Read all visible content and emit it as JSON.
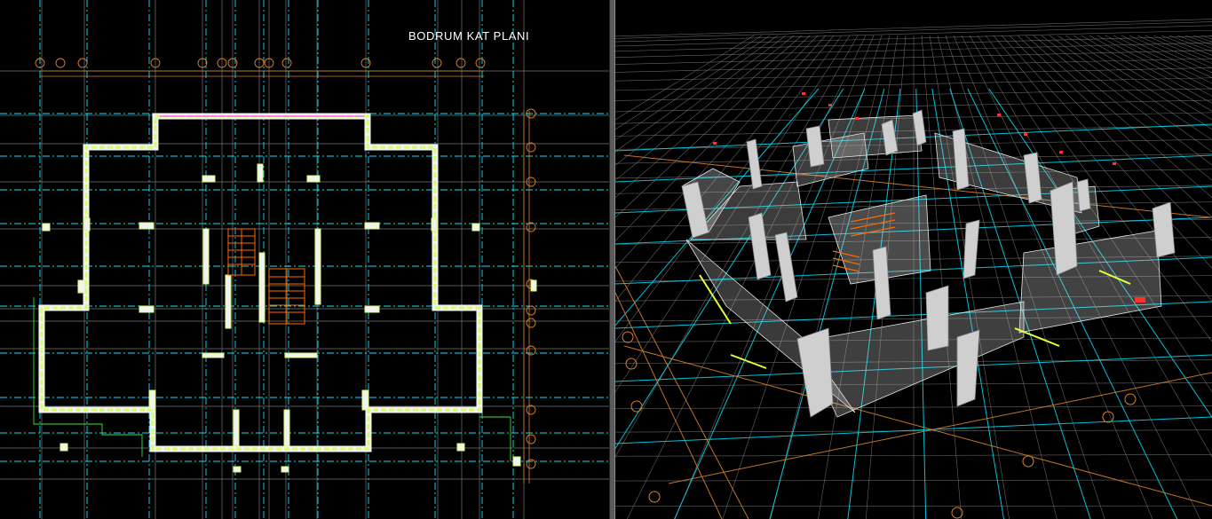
{
  "plan_view": {
    "title": "BODRUM KAT PLANI"
  },
  "colors": {
    "background": "#000000",
    "grid_white": "#9a9a9a",
    "grid_cyan": "#00e5ff",
    "axis_orange": "#d9822b",
    "wall_green": "#d4ff66",
    "wall_magenta": "#ff66ff",
    "stair_orange": "#ff6a00",
    "wall_grey": "#cfcfcf",
    "splitter": "#5a5a5a"
  },
  "icons": {
    "plan_axis_bubble": "circle-icon",
    "model_axis_bubble": "circle-icon"
  }
}
